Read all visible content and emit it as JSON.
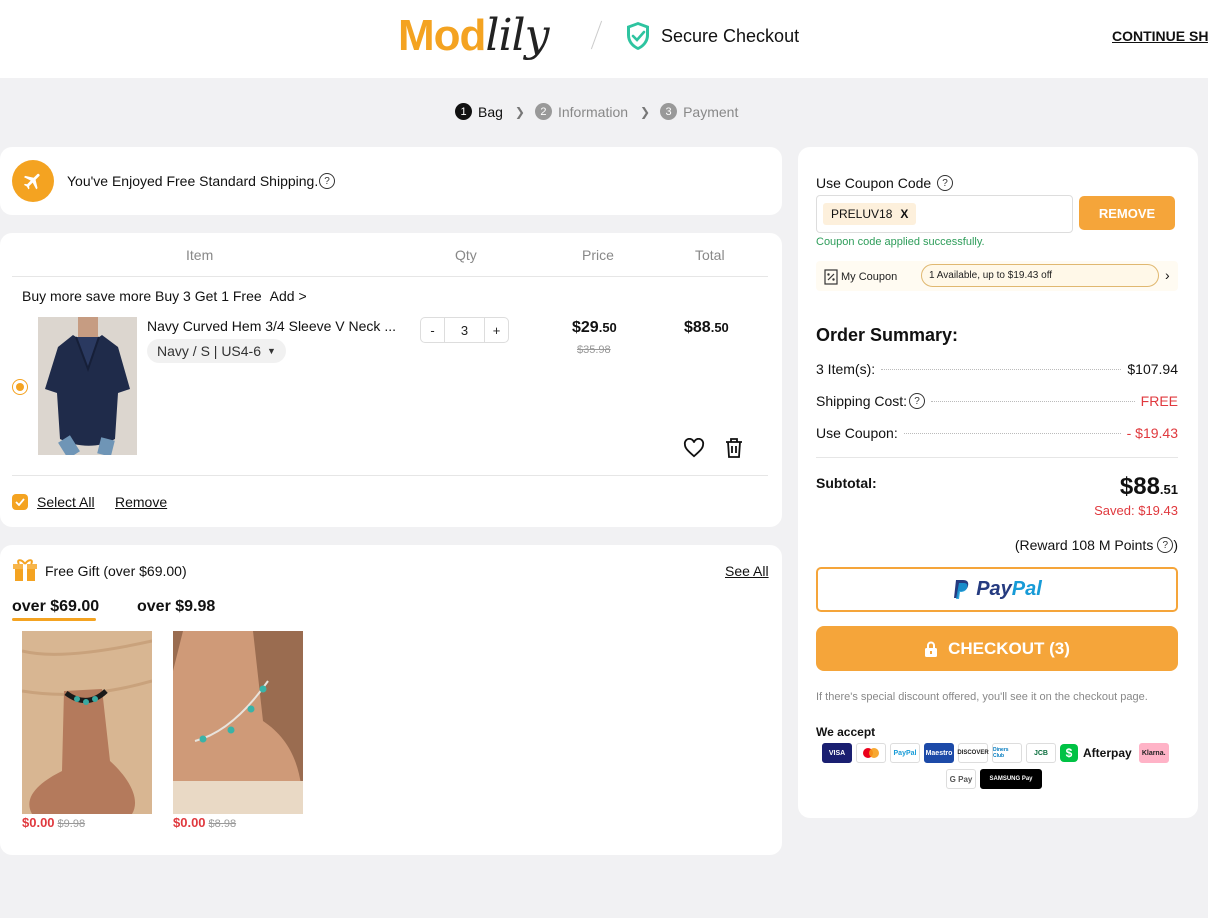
{
  "header": {
    "logo_part1": "Mod",
    "logo_part2": "lily",
    "secure_text": "Secure Checkout",
    "continue_label": "CONTINUE SHO"
  },
  "steps": [
    {
      "num": "1",
      "label": "Bag",
      "active": true
    },
    {
      "num": "2",
      "label": "Information",
      "active": false
    },
    {
      "num": "3",
      "label": "Payment",
      "active": false
    }
  ],
  "shipping_banner": {
    "text": "You've Enjoyed Free Standard Shipping.",
    "help": "?"
  },
  "cart": {
    "headers": {
      "item": "Item",
      "qty": "Qty",
      "price": "Price",
      "total": "Total"
    },
    "promo_text": "Buy more save more Buy 3 Get 1 Free",
    "promo_add": "Add >",
    "product": {
      "name": "Navy Curved Hem 3/4 Sleeve V Neck ...",
      "variant": "Navy / S | US4-6",
      "qty_minus": "-",
      "qty_value": "3",
      "qty_plus": "+",
      "price_main": "$29",
      "price_cents": ".50",
      "price_old": "$35.98",
      "total_main": "$88",
      "total_cents": ".50"
    },
    "select_all": "Select All",
    "remove": "Remove"
  },
  "gift": {
    "title": "Free Gift (over $69.00)",
    "see_all": "See All",
    "tabs": [
      {
        "label": "over $69.00",
        "active": true
      },
      {
        "label": "over $9.98",
        "active": false
      }
    ],
    "items": [
      {
        "price": "$0.00",
        "old_price": "$9.98"
      },
      {
        "price": "$0.00",
        "old_price": "$8.98"
      }
    ]
  },
  "coupon": {
    "title": "Use Coupon Code",
    "help": "?",
    "code": "PRELUV18",
    "code_remove": "X",
    "remove_button": "REMOVE",
    "success": "Coupon code applied successfully.",
    "my_coupon_label": "My Coupon",
    "my_coupon_info": "1 Available, up to $19.43 off",
    "arrow": "›"
  },
  "summary": {
    "title": "Order Summary:",
    "items_label": "3 Item(s):",
    "items_value": "$107.94",
    "shipping_label": "Shipping Cost:",
    "shipping_value": "FREE",
    "coupon_label": "Use Coupon:",
    "coupon_value": "- $19.43",
    "subtotal_label": "Subtotal:",
    "subtotal_main": "$88",
    "subtotal_cents": ".51",
    "saved": "Saved: $19.43",
    "reward": "(Reward 108 M Points",
    "reward_close": ")"
  },
  "buttons": {
    "paypal_1": "Pay",
    "paypal_2": "Pal",
    "checkout": "CHECKOUT (3)"
  },
  "payment": {
    "note": "If there's special discount offered, you'll see it on the checkout page.",
    "we_accept": "We accept",
    "methods_row1": [
      "VISA",
      "MC",
      "PayPal",
      "Maestro",
      "DISCOVER",
      "Diners Club",
      "JCB"
    ],
    "afterpay": "Afterpay",
    "klarna": "Klarna.",
    "methods_row2": [
      "G Pay",
      "SAMSUNG Pay"
    ]
  },
  "colors": {
    "accent": "#f5a53a",
    "brand_orange": "#f4a321",
    "sale_red": "#e0393e",
    "success_green": "#2e9d5a"
  }
}
